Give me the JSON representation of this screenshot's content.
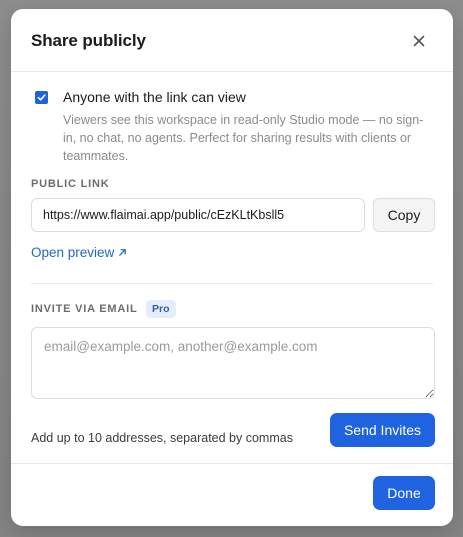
{
  "modal": {
    "title": "Share publicly",
    "close_icon": "close-icon"
  },
  "public_access": {
    "checked": true,
    "label": "Anyone with the link can view",
    "description": "Viewers see this workspace in read-only Studio mode — no sign-in, no chat, no agents. Perfect for sharing results with clients or teammates."
  },
  "public_link": {
    "section_label": "PUBLIC LINK",
    "url": "https://www.flaimai.app/public/cEzKLtKbsll5",
    "copy_label": "Copy",
    "preview_label": "Open preview",
    "preview_icon": "arrow-up-right-icon"
  },
  "invite": {
    "section_label": "INVITE VIA EMAIL",
    "badge": "Pro",
    "placeholder": "email@example.com, another@example.com",
    "hint": "Add up to 10 addresses, separated by commas",
    "send_label": "Send Invites"
  },
  "footer": {
    "done_label": "Done"
  },
  "colors": {
    "accent": "#1f63e0",
    "link": "#2266cc"
  }
}
